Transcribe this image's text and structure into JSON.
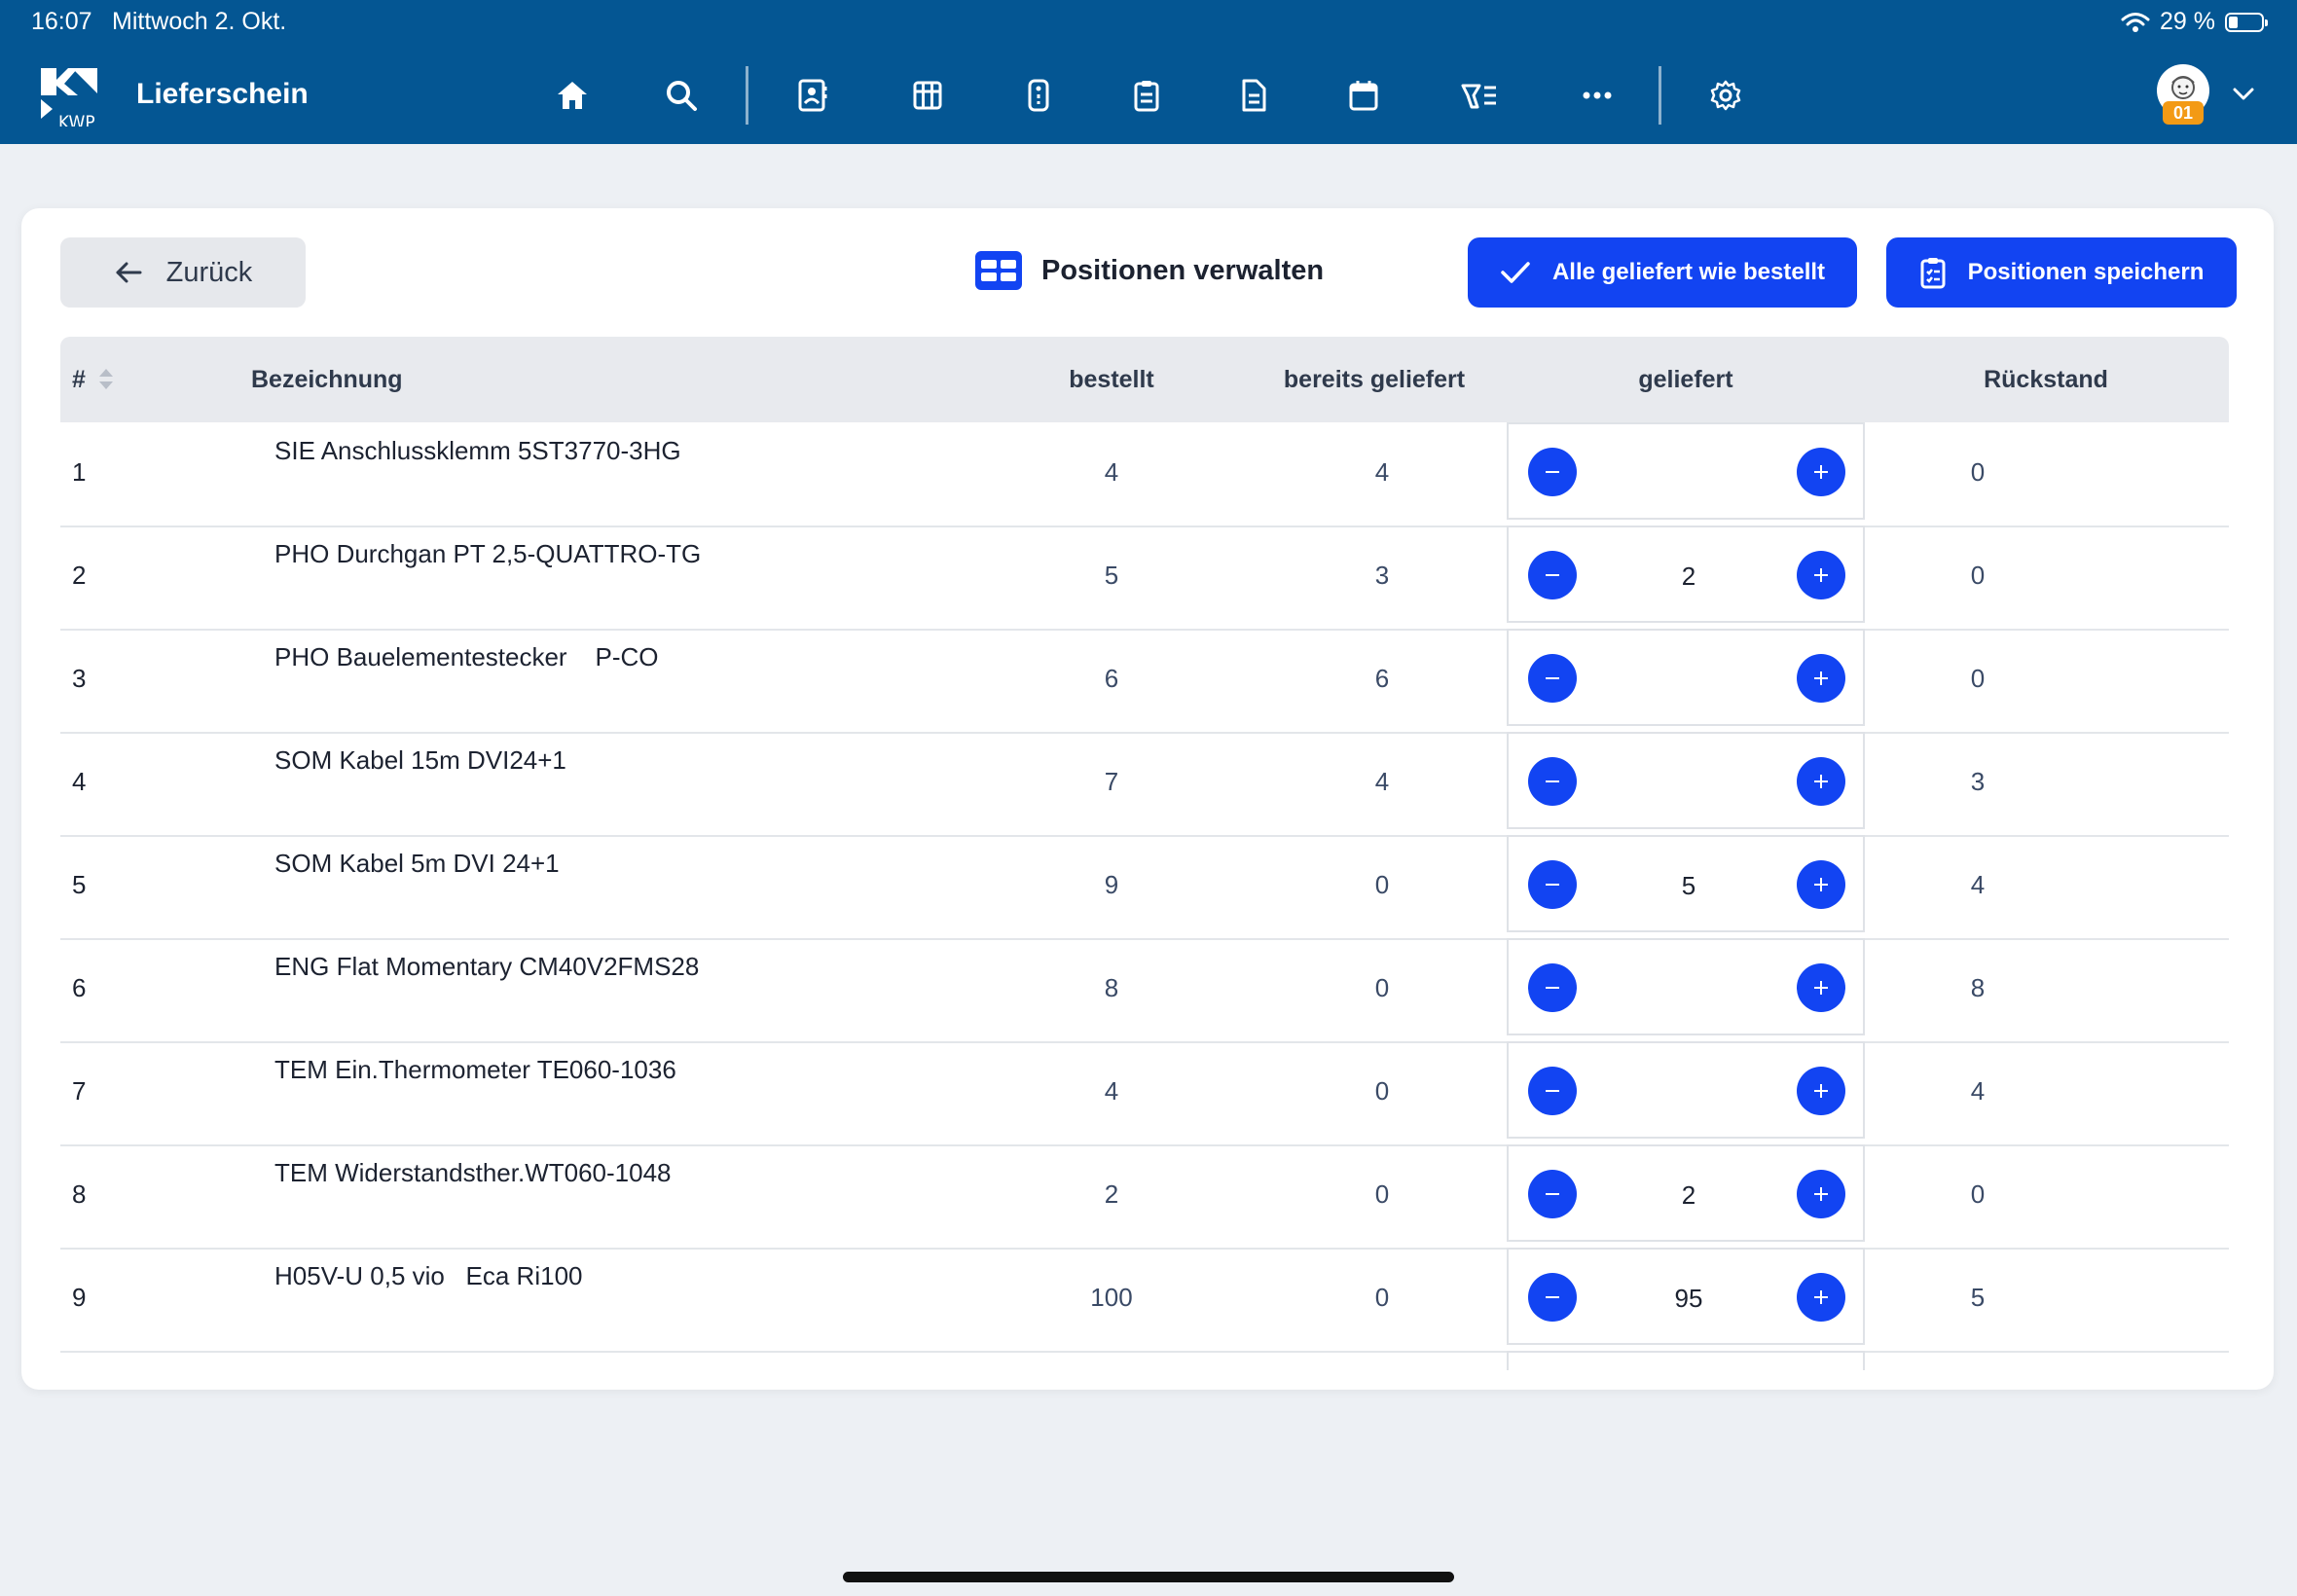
{
  "status": {
    "time": "16:07",
    "date": "Mittwoch 2. Okt.",
    "battery": "29 %",
    "battery_level": 0.29
  },
  "header": {
    "app_title": "Lieferschein",
    "nav_icons": [
      "home-icon",
      "search-icon",
      "contacts-icon",
      "grid-icon",
      "remote-icon",
      "clipboard-icon",
      "document-icon",
      "calendar-icon",
      "tools-list-icon",
      "more-icon",
      "settings-icon"
    ],
    "user_badge": "01"
  },
  "toolbar": {
    "back_label": "Zurück",
    "panel_title": "Positionen verwalten",
    "deliver_all_label": "Alle geliefert wie bestellt",
    "save_label": "Positionen speichern"
  },
  "table": {
    "headers": {
      "num": "#",
      "name": "Bezeichnung",
      "ordered": "bestellt",
      "already": "bereits geliefert",
      "delivered": "geliefert",
      "backlog": "Rückstand"
    },
    "rows": [
      {
        "num": "1",
        "name": "SIE Anschlussklemm 5ST3770-3HG",
        "ordered": "4",
        "already": "4",
        "delivered": "",
        "backlog": "0"
      },
      {
        "num": "2",
        "name": "PHO Durchgan PT 2,5-QUATTRO-TG",
        "ordered": "5",
        "already": "3",
        "delivered": "2",
        "backlog": "0"
      },
      {
        "num": "3",
        "name": "PHO Bauelementestecker    P-CO",
        "ordered": "6",
        "already": "6",
        "delivered": "",
        "backlog": "0"
      },
      {
        "num": "4",
        "name": "SOM Kabel 15m DVI24+1",
        "ordered": "7",
        "already": "4",
        "delivered": "",
        "backlog": "3"
      },
      {
        "num": "5",
        "name": "SOM Kabel 5m DVI 24+1",
        "ordered": "9",
        "already": "0",
        "delivered": "5",
        "backlog": "4"
      },
      {
        "num": "6",
        "name": "ENG Flat Momentary CM40V2FMS28",
        "ordered": "8",
        "already": "0",
        "delivered": "",
        "backlog": "8"
      },
      {
        "num": "7",
        "name": "TEM Ein.Thermometer TE060-1036",
        "ordered": "4",
        "already": "0",
        "delivered": "",
        "backlog": "4"
      },
      {
        "num": "8",
        "name": "TEM Widerstandsther.WT060-1048",
        "ordered": "2",
        "already": "0",
        "delivered": "2",
        "backlog": "0"
      },
      {
        "num": "9",
        "name": "H05V-U 0,5 vio   Eca Ri100",
        "ordered": "100",
        "already": "0",
        "delivered": "95",
        "backlog": "5"
      }
    ]
  },
  "colors": {
    "header_bg": "#045693",
    "primary": "#1244f2",
    "badge": "#f39a15",
    "page_bg": "#edf0f4"
  }
}
